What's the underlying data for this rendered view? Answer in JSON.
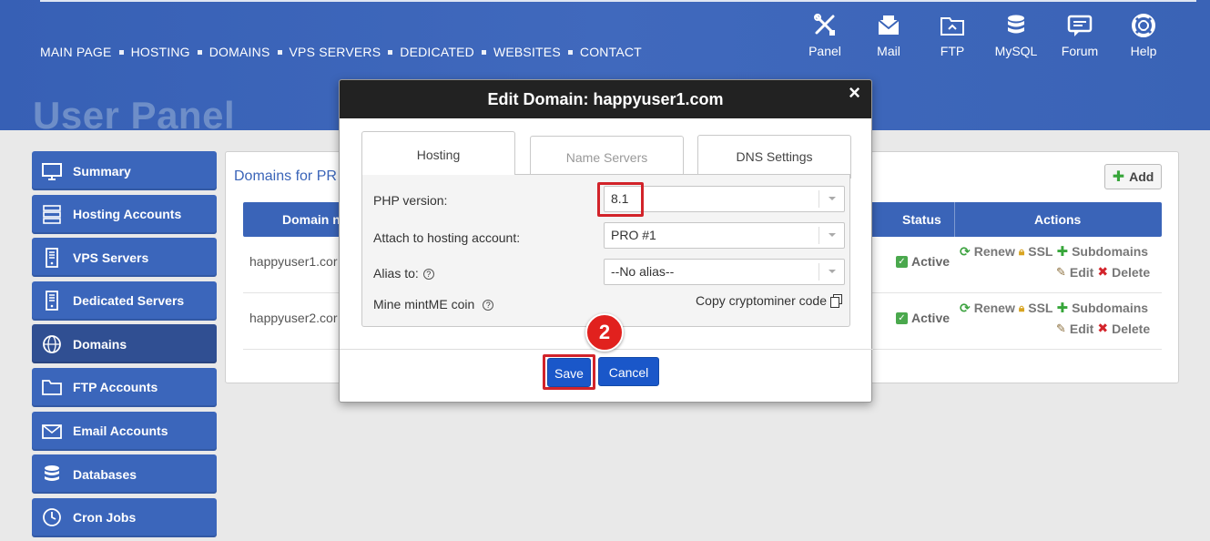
{
  "topnav": {
    "items": [
      "MAIN PAGE",
      "HOSTING",
      "DOMAINS",
      "VPS SERVERS",
      "DEDICATED",
      "WEBSITES",
      "CONTACT"
    ]
  },
  "quicknav": {
    "items": [
      {
        "label": "Panel",
        "icon": "tools-icon"
      },
      {
        "label": "Mail",
        "icon": "mail-icon"
      },
      {
        "label": "FTP",
        "icon": "folder-icon"
      },
      {
        "label": "MySQL",
        "icon": "database-icon"
      },
      {
        "label": "Forum",
        "icon": "chat-icon"
      },
      {
        "label": "Help",
        "icon": "lifebuoy-icon"
      }
    ]
  },
  "page_title": "User Panel",
  "sidebar": {
    "items": [
      {
        "label": "Summary",
        "icon": "monitor-icon"
      },
      {
        "label": "Hosting Accounts",
        "icon": "server-icon"
      },
      {
        "label": "VPS Servers",
        "icon": "vps-icon"
      },
      {
        "label": "Dedicated Servers",
        "icon": "dedicated-icon"
      },
      {
        "label": "Domains",
        "icon": "globe-icon"
      },
      {
        "label": "FTP Accounts",
        "icon": "folder-icon"
      },
      {
        "label": "Email Accounts",
        "icon": "envelope-icon"
      },
      {
        "label": "Databases",
        "icon": "database-icon"
      },
      {
        "label": "Cron Jobs",
        "icon": "clock-icon"
      }
    ],
    "active": "Domains"
  },
  "domains": {
    "heading": "Domains for PR",
    "add_label": "Add",
    "columns": {
      "domain": "Domain n",
      "status": "Status",
      "actions": "Actions"
    },
    "rows": [
      {
        "domain": "happyuser1.cor",
        "status": "Active"
      },
      {
        "domain": "happyuser2.cor",
        "status": "Active"
      }
    ],
    "actions": {
      "renew": "Renew",
      "ssl": "SSL",
      "subdomains": "Subdomains",
      "edit": "Edit",
      "delete": "Delete"
    }
  },
  "modal": {
    "title": "Edit Domain: happyuser1.com",
    "close": "×",
    "tabs": [
      "Hosting",
      "Name Servers",
      "DNS Settings"
    ],
    "active_tab": "Hosting",
    "php_label": "PHP version:",
    "php_value": "8.1",
    "attach_label": "Attach to hosting account:",
    "attach_value": "PRO #1",
    "alias_label": "Alias to:",
    "alias_value": "--No alias--",
    "mine_label": "Mine mintME coin",
    "copy_label": "Copy cryptominer code",
    "help_glyph": "?",
    "save_label": "Save",
    "cancel_label": "Cancel",
    "step_number": "2"
  },
  "colors": {
    "brand_blue": "#3a64b8",
    "highlight_red": "#d2232a",
    "button_blue": "#1a57c9"
  }
}
